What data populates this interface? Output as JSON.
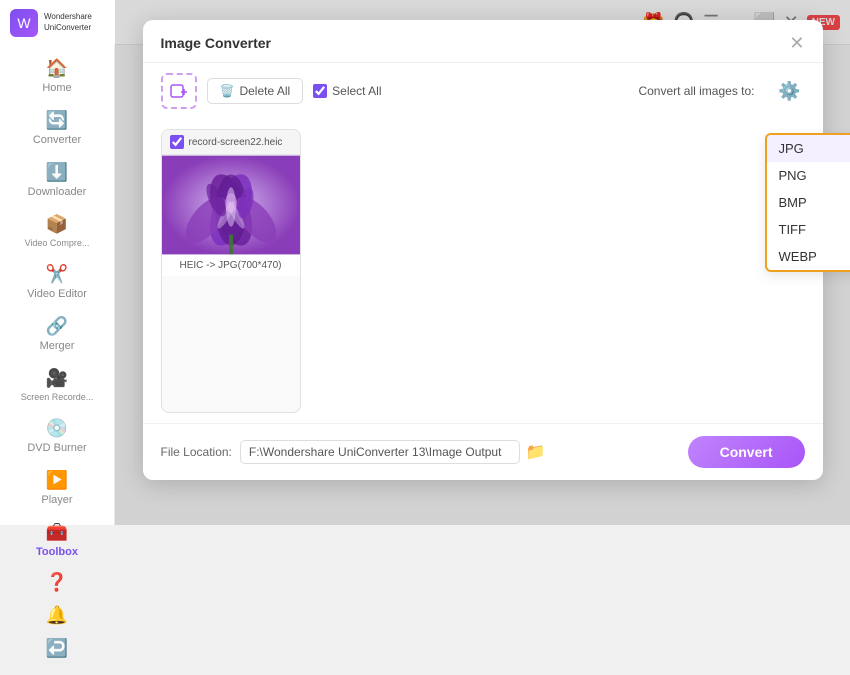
{
  "app": {
    "title": "Wondershare UniConverter",
    "logo_text": "Wondershare\nUniConverter"
  },
  "sidebar": {
    "items": [
      {
        "id": "home",
        "label": "Home",
        "icon": "🏠"
      },
      {
        "id": "converter",
        "label": "Converter",
        "icon": "🔄"
      },
      {
        "id": "downloader",
        "label": "Downloader",
        "icon": "⬇️"
      },
      {
        "id": "video-compress",
        "label": "Video Compre...",
        "icon": "📦"
      },
      {
        "id": "video-editor",
        "label": "Video Editor",
        "icon": "✂️"
      },
      {
        "id": "merger",
        "label": "Merger",
        "icon": "🔗"
      },
      {
        "id": "screen-recorder",
        "label": "Screen Recorde...",
        "icon": "🎥"
      },
      {
        "id": "dvd-burner",
        "label": "DVD Burner",
        "icon": "💿"
      },
      {
        "id": "player",
        "label": "Player",
        "icon": "▶️"
      },
      {
        "id": "toolbox",
        "label": "Toolbox",
        "icon": "🧰",
        "active": true
      }
    ],
    "bottom_icons": [
      "❓",
      "🔔",
      "↩️"
    ]
  },
  "topbar": {
    "icons": [
      "🎁",
      "🎧",
      "☰",
      "—",
      "⬜",
      "✕"
    ],
    "new_badge": "NEW"
  },
  "modal": {
    "title": "Image Converter",
    "toolbar": {
      "delete_all_label": "Delete All",
      "select_all_label": "Select All",
      "convert_all_label": "Convert all images to:"
    },
    "format_options": [
      "JPG",
      "PNG",
      "BMP",
      "TIFF",
      "WEBP"
    ],
    "selected_format": "JPG",
    "image_cards": [
      {
        "filename": "record-screen22.heic",
        "label": "HEIC -> JPG(700*470)",
        "checked": true
      }
    ],
    "footer": {
      "file_location_label": "File Location:",
      "file_path": "F:\\Wondershare UniConverter 13\\Image Output",
      "convert_button": "Convert"
    }
  }
}
